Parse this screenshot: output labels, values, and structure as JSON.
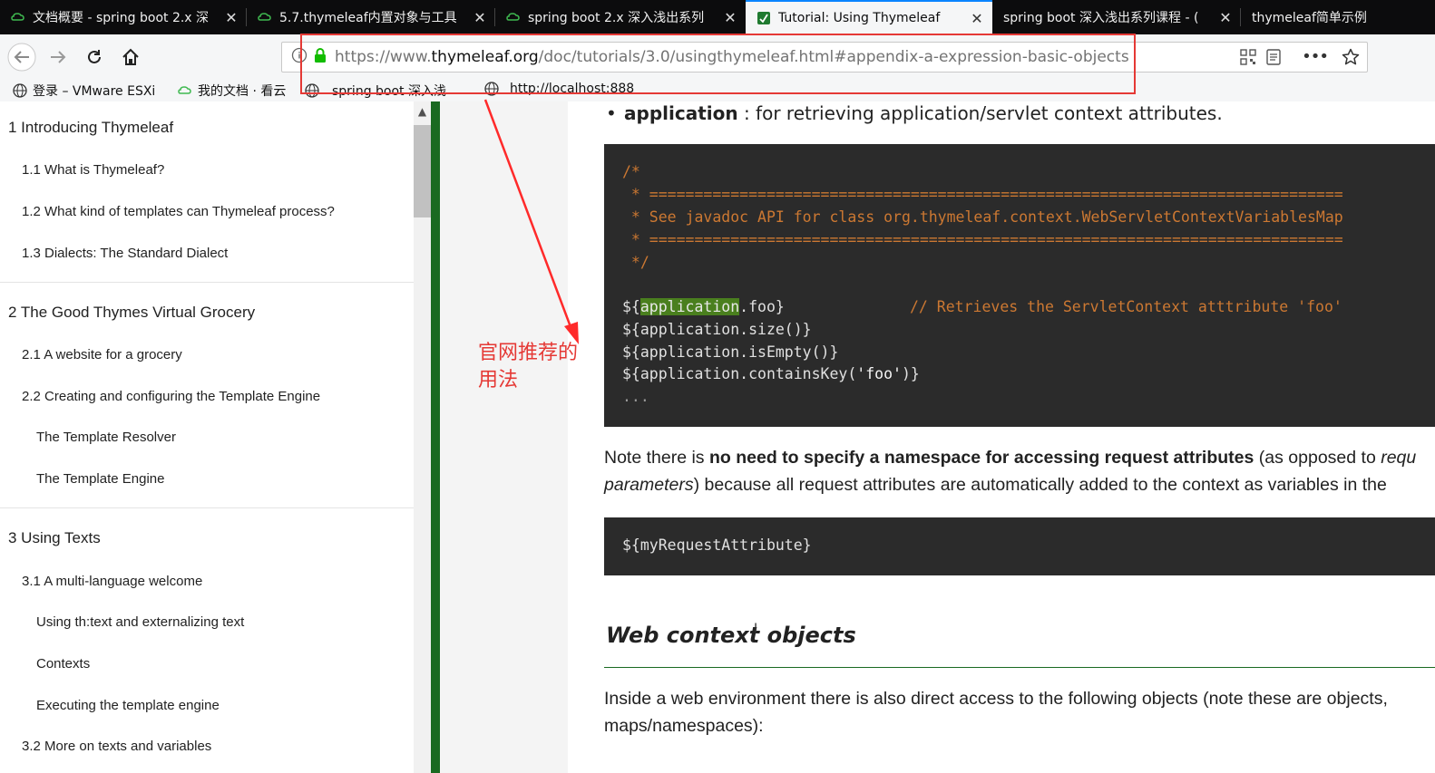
{
  "tabs": [
    {
      "label": "文档概要 - spring boot 2.x 深",
      "icon": "cloud-icon",
      "active": false
    },
    {
      "label": "5.7.thymeleaf内置对象与工具",
      "icon": "cloud-icon",
      "active": false
    },
    {
      "label": "spring boot 2.x 深入浅出系列",
      "icon": "cloud-icon",
      "active": false
    },
    {
      "label": "Tutorial: Using Thymeleaf",
      "icon": "thymeleaf-leaf-icon",
      "active": true
    },
    {
      "label": "spring boot 深入浅出系列课程 - (",
      "icon": "",
      "active": false
    },
    {
      "label": "thymeleaf简单示例",
      "icon": "",
      "active": false
    }
  ],
  "nav": {
    "url_prefix": "https://www.",
    "url_host": "thymeleaf.org",
    "url_path": "/doc/tutorials/3.0/usingthymeleaf.html#appendix-a-expression-basic-objects"
  },
  "bookmarks": [
    {
      "label": "登录 – VMware ESXi",
      "icon": "globe-icon"
    },
    {
      "label": "我的文档 · 看云",
      "icon": "cloud-icon"
    },
    {
      "label": "spring boot 深入浅",
      "icon": "globe-icon"
    },
    {
      "label": "http://localhost:888",
      "icon": "globe-icon"
    }
  ],
  "toc": [
    {
      "label": "1 Introducing Thymeleaf",
      "level": 1
    },
    {
      "label": "1.1 What is Thymeleaf?",
      "level": 2
    },
    {
      "label": "1.2 What kind of templates can Thymeleaf process?",
      "level": 2
    },
    {
      "label": "1.3 Dialects: The Standard Dialect",
      "level": 2
    },
    {
      "label": "2 The Good Thymes Virtual Grocery",
      "level": 1
    },
    {
      "label": "2.1 A website for a grocery",
      "level": 2
    },
    {
      "label": "2.2 Creating and configuring the Template Engine",
      "level": 2
    },
    {
      "label": "The Template Resolver",
      "level": 3
    },
    {
      "label": "The Template Engine",
      "level": 3
    },
    {
      "label": "3 Using Texts",
      "level": 1
    },
    {
      "label": "3.1 A multi-language welcome",
      "level": 2
    },
    {
      "label": "Using th:text and externalizing text",
      "level": 3
    },
    {
      "label": "Contexts",
      "level": 3
    },
    {
      "label": "Executing the template engine",
      "level": 3
    },
    {
      "label": "3.2 More on texts and variables",
      "level": 2
    }
  ],
  "annotation": {
    "line1": "官网推荐的",
    "line2": "用法"
  },
  "content": {
    "bullet_term": "application",
    "bullet_rest": " : for retrieving application/servlet context attributes.",
    "code1": {
      "c1": "/*",
      "c2": " * =============================================================================",
      "c3": " * See javadoc API for class org.thymeleaf.context.WebServletContextVariablesMap",
      "c4": " * =============================================================================",
      "c5": " */",
      "l1_pre": "${",
      "l1_hl": "application",
      "l1_post": ".foo}",
      "l1_comment": "// Retrieves the ServletContext atttribute 'foo'",
      "l2": "${application.size()}",
      "l3": "${application.isEmpty()}",
      "l4_pre": "${application.containsKey(",
      "l4_str": "'foo'",
      "l4_post": ")}",
      "l5": "..."
    },
    "note_p1_a": "Note there is ",
    "note_p1_b": "no need to specify a namespace for accessing request attributes",
    "note_p1_c": " (as opposed to ",
    "note_p1_d": "requ",
    "note_p2_a": "parameters",
    "note_p2_b": ") because all request attributes are automatically added to the context as variables in the",
    "code2": "${myRequestAttribute}",
    "heading": "Web context objects",
    "inside_p1": "Inside a web environment there is also direct access to the following objects (note these are objects,",
    "inside_p2": "maps/namespaces):"
  }
}
